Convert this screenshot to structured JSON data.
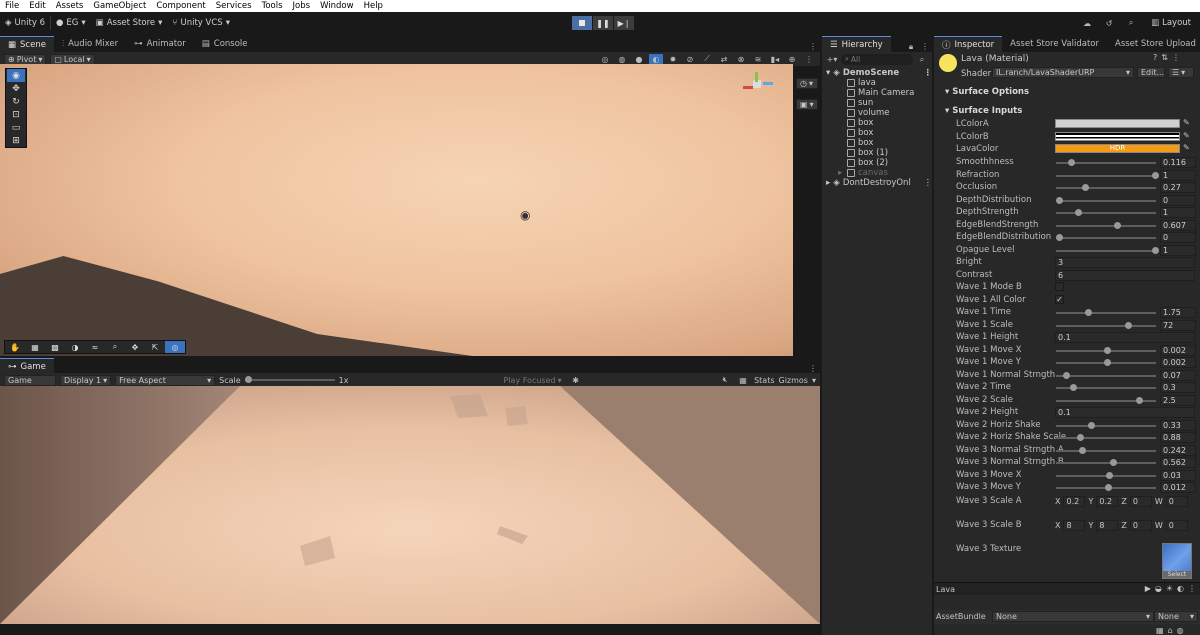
{
  "menu": [
    "File",
    "Edit",
    "Assets",
    "GameObject",
    "Component",
    "Services",
    "Tools",
    "Jobs",
    "Window",
    "Help"
  ],
  "toolbar": {
    "unity_label": "Unity 6",
    "account": "EG",
    "asset_store": "Asset Store",
    "vcs": "Unity VCS",
    "layout": "Layout"
  },
  "scene_tabs": [
    "Scene",
    "Audio Mixer",
    "Animator",
    "Console"
  ],
  "scene_bar": {
    "pivot": "Pivot",
    "local": "Local"
  },
  "game": {
    "tab": "Game",
    "mode": "Game",
    "display": "Display 1",
    "aspect": "Free Aspect",
    "scale_label": "Scale",
    "scale_value": "1x",
    "play_focused": "Play Focused",
    "stats": "Stats",
    "gizmos": "Gizmos"
  },
  "hierarchy": {
    "tab": "Hierarchy",
    "search_placeholder": "All",
    "scene": "DemoScene",
    "items": [
      "lava",
      "Main Camera",
      "sun",
      "volume",
      "box",
      "box",
      "box",
      "box (1)",
      "box (2)",
      "canvas"
    ],
    "dont_destroy": "DontDestroyOnl"
  },
  "inspector": {
    "tabs": [
      "Inspector",
      "Asset Store Validator",
      "Asset Store Upload"
    ],
    "title": "Lava (Material)",
    "shader_label": "Shader",
    "shader_value": "IL.ranch/LavaShaderURP",
    "edit_label": "Edit...",
    "surface_options": "Surface Options",
    "surface_inputs": "Surface Inputs",
    "hdr_label": "HDR",
    "color_props": [
      "LColorA",
      "LColorB",
      "LavaColor"
    ],
    "slider_props": [
      {
        "name": "Smoothhness",
        "value": "0.116",
        "frac": 0.12
      },
      {
        "name": "Refraction",
        "value": "1",
        "frac": 1.0
      },
      {
        "name": "Occlusion",
        "value": "0.27",
        "frac": 0.27
      },
      {
        "name": "DepthDistribution",
        "value": "0",
        "frac": 0.0
      },
      {
        "name": "DepthStrength",
        "value": "1",
        "frac": 0.2
      },
      {
        "name": "EdgeBlendStrength",
        "value": "0.607",
        "frac": 0.6
      },
      {
        "name": "EdgeBlendDistribution",
        "value": "0",
        "frac": 0.0
      },
      {
        "name": "Opague Level",
        "value": "1",
        "frac": 1.0
      }
    ],
    "bright_label": "Bright",
    "bright_value": "3",
    "contrast_label": "Contrast",
    "contrast_value": "6",
    "mode_b_label": "Wave 1 Mode B",
    "all_color_label": "Wave 1 All Color",
    "all_color_check": "✓",
    "wave_props": [
      {
        "name": "Wave 1 Time",
        "value": "1.75",
        "frac": 0.3
      },
      {
        "name": "Wave 1 Scale",
        "value": "72",
        "frac": 0.72
      }
    ],
    "w1_height_label": "Wave 1 Height",
    "w1_height_value": "0.1",
    "wave_props2": [
      {
        "name": "Wave 1 Move X",
        "value": "0.002",
        "frac": 0.5
      },
      {
        "name": "Wave 1 Move Y",
        "value": "0.002",
        "frac": 0.5
      },
      {
        "name": "Wave 1 Normal Strngth",
        "value": "0.07",
        "frac": 0.07
      },
      {
        "name": "Wave 2 Time",
        "value": "0.3",
        "frac": 0.15
      },
      {
        "name": "Wave 2 Scale",
        "value": "2.5",
        "frac": 0.83
      }
    ],
    "w2_height_label": "Wave 2 Height",
    "w2_height_value": "0.1",
    "wave_props3": [
      {
        "name": "Wave 2 Horiz Shake",
        "value": "0.33",
        "frac": 0.33
      },
      {
        "name": "Wave 2 Horiz Shake Scale",
        "value": "0.88",
        "frac": 0.22
      },
      {
        "name": "Wave 3 Normal Strngth A",
        "value": "0.242",
        "frac": 0.24
      },
      {
        "name": "Wave 3 Normal Strngth B",
        "value": "0.562",
        "frac": 0.56
      },
      {
        "name": "Wave 3 Move X",
        "value": "0.03",
        "frac": 0.52
      },
      {
        "name": "Wave 3 Move Y",
        "value": "0.012",
        "frac": 0.51
      }
    ],
    "w3_scale_a": {
      "label": "Wave 3 Scale A",
      "x": "0.2",
      "y": "0.2",
      "z": "0",
      "w": "0"
    },
    "w3_scale_b": {
      "label": "Wave 3 Scale B",
      "x": "8",
      "y": "8",
      "z": "0",
      "w": "0"
    },
    "w3_texture": "Wave 3 Texture",
    "select_label": "Select",
    "preview_label": "Lava",
    "assetbundle_label": "AssetBundle",
    "assetbundle_value": "None",
    "assetbundle_variant": "None"
  }
}
